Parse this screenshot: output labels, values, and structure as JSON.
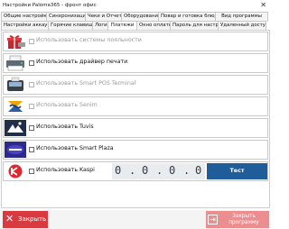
{
  "window": {
    "title": "Настройки Paloma365 - фронт офис",
    "close_glyph": "✕"
  },
  "tabs": {
    "row1": [
      "Общие настройки",
      "Синхронизация",
      "Чеки и Отчеты",
      "Оборудование",
      "Повар и готовка блюд",
      "Вид программы"
    ],
    "row2": [
      "Настройки аккаунта",
      "Горячие клавиши",
      "Логи",
      "Платежи",
      "Окно оплаты",
      "Пароль для настроек",
      "Удаленный доступ"
    ],
    "active": "Платежи"
  },
  "payments": [
    {
      "label": "Использовать системы лояльности",
      "enabled": false,
      "checked": false,
      "icon": "loyalty-gift-icon"
    },
    {
      "label": "Использовать драйвер печати",
      "enabled": true,
      "checked": false,
      "icon": "printer-driver-icon"
    },
    {
      "label": "Использовать Smart POS Terminal",
      "enabled": false,
      "checked": false,
      "icon": "smart-pos-terminal-icon"
    },
    {
      "label": "Использовать Senim",
      "enabled": false,
      "checked": false,
      "icon": "senim-logo-icon"
    },
    {
      "label": "Использовать Tuvis",
      "enabled": true,
      "checked": false,
      "icon": "tuvis-logo-icon"
    },
    {
      "label": "Использовать Smart Plaza",
      "enabled": true,
      "checked": false,
      "icon": "smart-plaza-logo-icon"
    },
    {
      "label": "Использовать Kaspi",
      "enabled": true,
      "checked": false,
      "icon": "kaspi-logo-icon"
    }
  ],
  "kaspi": {
    "ip_octets": [
      "0",
      "0",
      "0",
      "0"
    ],
    "ip_separator": ".",
    "test_button": "Тест подключения"
  },
  "footer": {
    "close_label": "Закрыть",
    "close_glyph": "✕",
    "save_label": "Закрыть\nпрограмму",
    "save_glyph": "⇥"
  },
  "colors": {
    "close_red": "#d93a3f",
    "test_blue": "#1f5c9a",
    "save_pink": "#ec8e90"
  }
}
